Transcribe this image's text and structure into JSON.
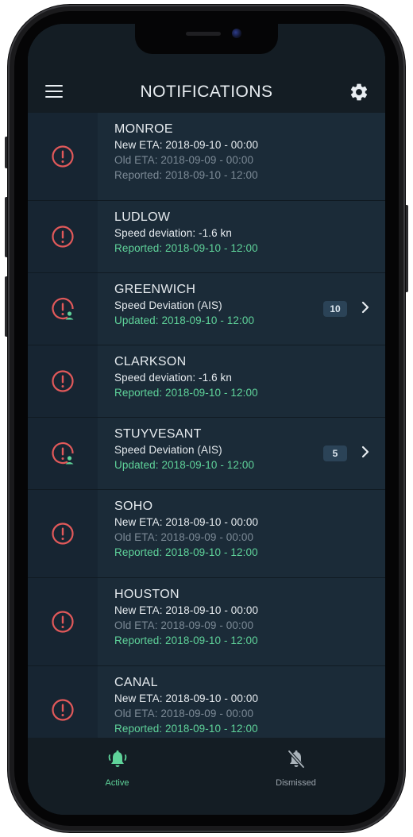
{
  "header": {
    "title": "NOTIFICATIONS",
    "menu_icon": "menu-icon",
    "settings_icon": "gear-icon"
  },
  "colors": {
    "header_bg": "#141d24",
    "list_bg": "#1b2b38",
    "icon_column_bg": "#172532",
    "alert_red": "#e2595a",
    "accent_green": "#5fd39a",
    "muted_text": "#7c8a96",
    "badge_bg": "#2b4357"
  },
  "notifications": [
    {
      "name": "MONROE",
      "icon": "alert-circle-icon",
      "lines": [
        {
          "text": "New ETA: 2018-09-10 - 00:00",
          "style": "primary"
        },
        {
          "text": "Old ETA: 2018-09-09 - 00:00",
          "style": "muted"
        },
        {
          "text": "Reported: 2018-09-10 - 12:00",
          "style": "muted"
        }
      ]
    },
    {
      "name": "LUDLOW",
      "icon": "alert-circle-icon",
      "lines": [
        {
          "text": "Speed deviation: -1.6 kn",
          "style": "primary"
        },
        {
          "text": "Reported: 2018-09-10 - 12:00",
          "style": "green"
        }
      ]
    },
    {
      "name": "GREENWICH",
      "icon": "alert-circle-user-icon",
      "lines": [
        {
          "text": "Speed Deviation (AIS)",
          "style": "primary"
        },
        {
          "text": "Updated: 2018-09-10 - 12:00",
          "style": "green"
        }
      ],
      "count": "10"
    },
    {
      "name": "CLARKSON",
      "icon": "alert-circle-icon",
      "lines": [
        {
          "text": "Speed deviation: -1.6 kn",
          "style": "primary"
        },
        {
          "text": "Reported: 2018-09-10 - 12:00",
          "style": "green"
        }
      ]
    },
    {
      "name": "STUYVESANT",
      "icon": "alert-circle-user-icon",
      "lines": [
        {
          "text": "Speed Deviation (AIS)",
          "style": "primary"
        },
        {
          "text": "Updated: 2018-09-10 - 12:00",
          "style": "green"
        }
      ],
      "count": "5"
    },
    {
      "name": "SOHO",
      "icon": "alert-circle-icon",
      "lines": [
        {
          "text": "New ETA: 2018-09-10 - 00:00",
          "style": "primary"
        },
        {
          "text": "Old ETA: 2018-09-09 - 00:00",
          "style": "muted"
        },
        {
          "text": "Reported: 2018-09-10 - 12:00",
          "style": "green"
        }
      ]
    },
    {
      "name": "HOUSTON",
      "icon": "alert-circle-icon",
      "lines": [
        {
          "text": "New ETA: 2018-09-10 - 00:00",
          "style": "primary"
        },
        {
          "text": "Old ETA: 2018-09-09 - 00:00",
          "style": "muted"
        },
        {
          "text": "Reported: 2018-09-10 - 12:00",
          "style": "green"
        }
      ]
    },
    {
      "name": "CANAL",
      "icon": "alert-circle-icon",
      "lines": [
        {
          "text": "New ETA: 2018-09-10 - 00:00",
          "style": "primary"
        },
        {
          "text": "Old ETA: 2018-09-09 - 00:00",
          "style": "muted"
        },
        {
          "text": "Reported: 2018-09-10 - 12:00",
          "style": "green"
        }
      ]
    }
  ],
  "tabs": [
    {
      "label": "Active",
      "icon": "bell-ringing-icon",
      "active": true
    },
    {
      "label": "Dismissed",
      "icon": "bell-off-icon",
      "active": false
    }
  ]
}
